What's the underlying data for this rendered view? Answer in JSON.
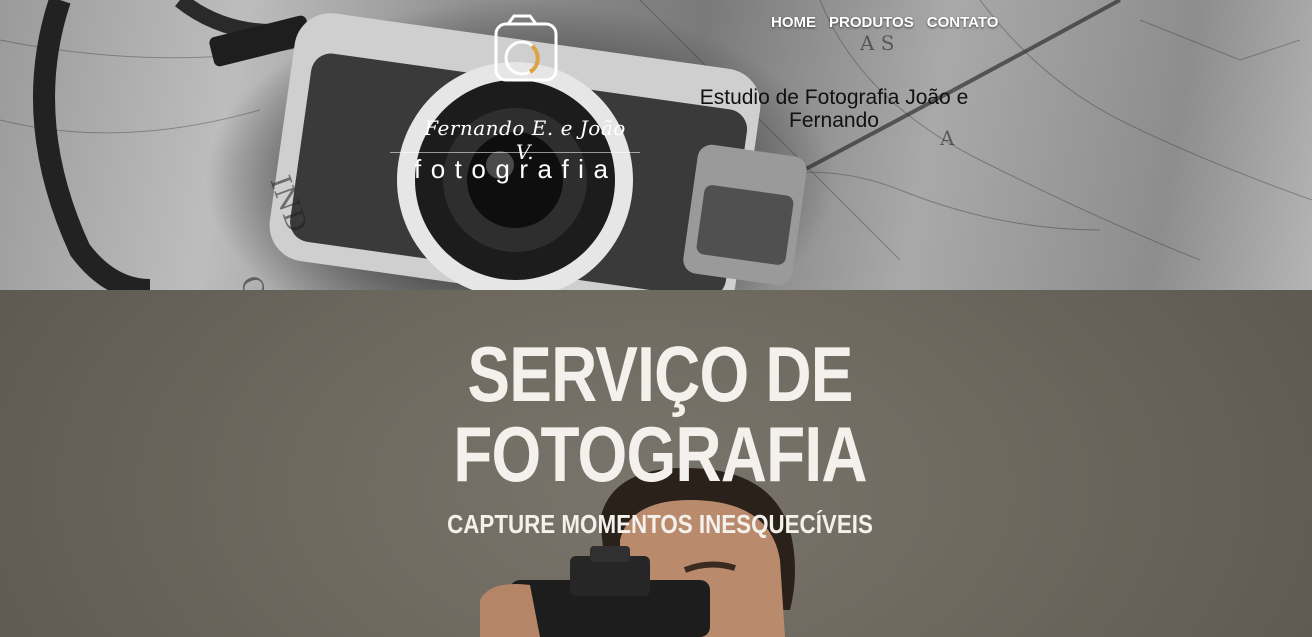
{
  "header": {
    "logo": {
      "script_text": "Fernando E. e João V.",
      "word": "fotografia",
      "icon": "camera-icon"
    },
    "nav": [
      {
        "label": "HOME"
      },
      {
        "label": "PRODUTOS"
      },
      {
        "label": "CONTATO"
      }
    ],
    "studio_title": "Estudio de Fotografia João e Fernando"
  },
  "hero": {
    "title": "SERVIÇO DE FOTOGRAFIA",
    "subtitle": "CAPTURE MOMENTOS INESQUECÍVEIS"
  },
  "colors": {
    "nav_text": "#ffffff",
    "hero_text": "#f4f1ec",
    "hero_bg": "#6e695f",
    "logo_accent": "#d9a441"
  }
}
